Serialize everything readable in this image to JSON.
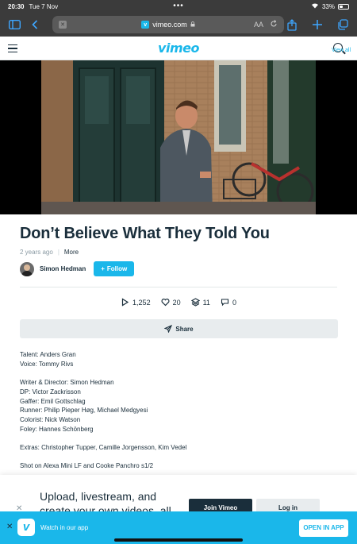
{
  "status_bar": {
    "time": "20:30",
    "date": "Tue 7 Nov",
    "battery": "33%",
    "battery_level": 0.33
  },
  "browser": {
    "url": "vimeo.com",
    "text_size": "AA"
  },
  "site": {
    "logo": "vimeo",
    "view_all": "View all"
  },
  "video": {
    "title": "Don’t Believe What They Told You",
    "age": "2 years ago",
    "more": "More",
    "author": "Simon Hedman",
    "follow_label": "Follow"
  },
  "stats": {
    "plays": "1,252",
    "likes": "20",
    "collections": "11",
    "comments": "0"
  },
  "share_label": "Share",
  "description": [
    "Talent: Anders Gran",
    "Voice: Tommy Rivs",
    "",
    "Writer & Director: Simon Hedman",
    "DP: Victor Zackrisson",
    "Gaffer: Emil Gottschlag",
    "Runner: Philip Pieper Høg, Michael Medgyesi",
    "Colorist: Nick Watson",
    "Foley: Hannes Schönberg",
    "",
    "Extras: Christopher Tupper, Camille Jorgensson, Kim Vedel",
    "",
    "Shot on Alexa Mini LF and Cooke Panchro s1/2"
  ],
  "promo": {
    "text": "Upload, livestream, and create your own videos, all",
    "join": "Join Vimeo",
    "login": "Log in"
  },
  "app_bar": {
    "text": "Watch in our app",
    "open": "OPEN IN APP"
  },
  "colors": {
    "accent": "#1ab7ea",
    "text": "#1a2e3b"
  }
}
